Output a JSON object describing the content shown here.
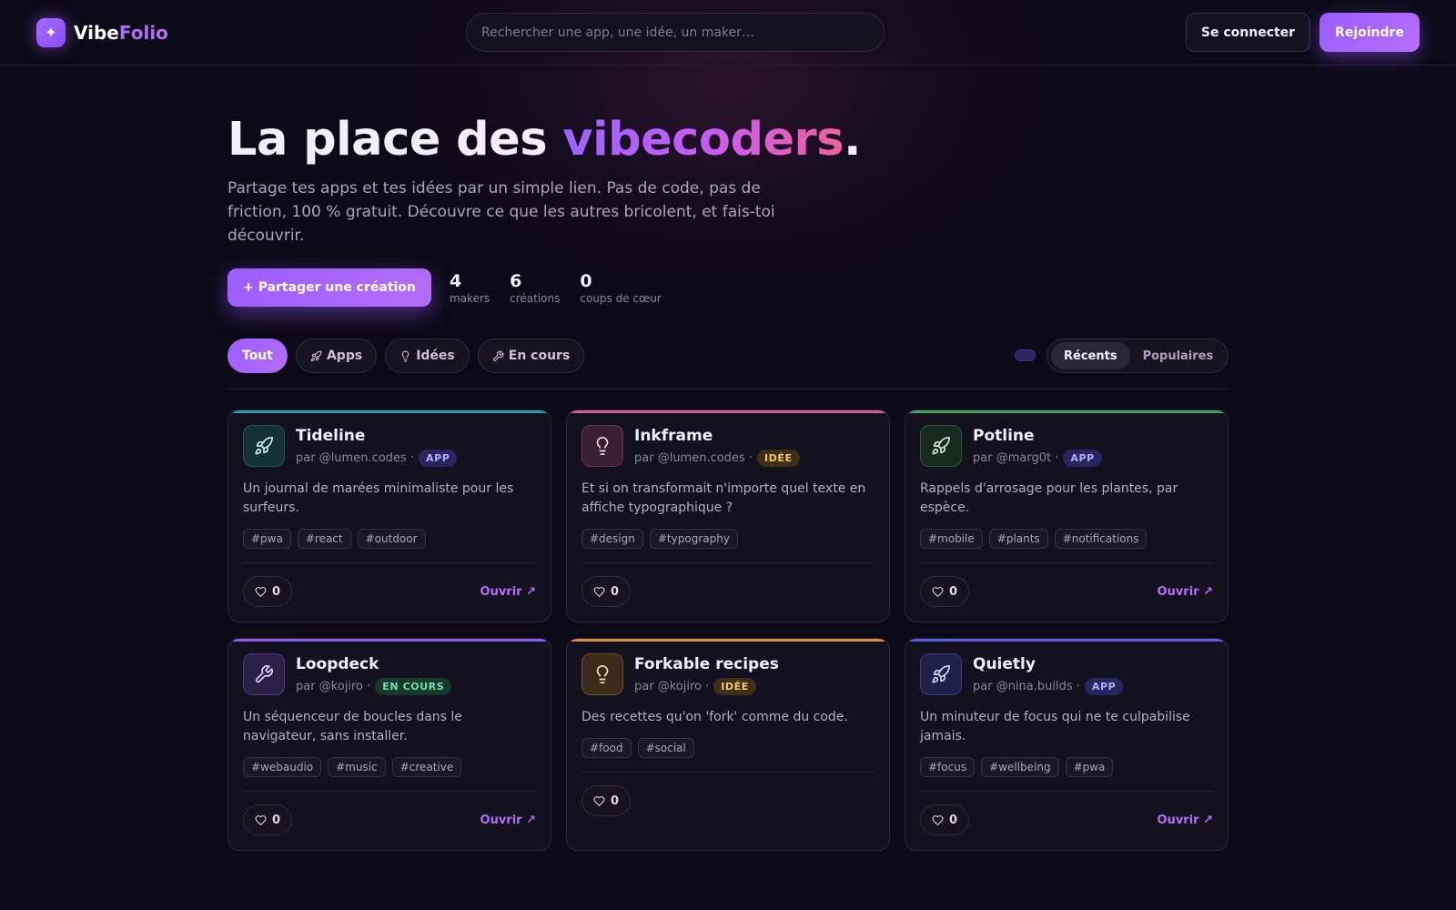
{
  "header": {
    "logo_part1": "Vibe",
    "logo_part2": "Folio",
    "logo_symbol": "✦",
    "search_placeholder": "Rechercher une app, une idée, un maker…",
    "login_label": "Se connecter",
    "join_label": "Rejoindre"
  },
  "hero": {
    "title_before": "La place des ",
    "title_highlight": "vibecoders",
    "title_after": ".",
    "subtitle": "Partage tes apps et tes idées par un simple lien. Pas de code, pas de friction, 100 % gratuit. Découvre ce que les autres bricolent, et fais-toi découvrir.",
    "share_label": "+ Partager une création",
    "stats": [
      {
        "value": "4",
        "label": "makers"
      },
      {
        "value": "6",
        "label": "créations"
      },
      {
        "value": "0",
        "label": "coups de cœur"
      }
    ]
  },
  "filters": {
    "items": [
      {
        "label": "Tout",
        "icon": "",
        "active": true
      },
      {
        "label": "Apps",
        "icon": "rocket-icon",
        "active": false
      },
      {
        "label": "Idées",
        "icon": "lightbulb-icon",
        "active": false
      },
      {
        "label": "En cours",
        "icon": "wrench-icon",
        "active": false
      }
    ],
    "sort_recent": "Récents",
    "sort_popular": "Populaires"
  },
  "cards": [
    {
      "title": "Tideline",
      "author": "par @lumen.codes ·",
      "badge": "APP",
      "description": "Un journal de marées minimaliste pour les surfeurs.",
      "tags": [
        "#pwa",
        "#react",
        "#outdoor"
      ],
      "likes": "0",
      "open": "Ouvrir ↗",
      "icon": "rocket-icon",
      "accent": "#2a9aa8",
      "icon_bg": "#163038",
      "icon_border": "#1f5560",
      "icon_color": "#bff0f5",
      "badge_bg": "#2a2560",
      "badge_color": "#b7adff"
    },
    {
      "title": "Inkframe",
      "author": "par @lumen.codes ·",
      "badge": "IDÉE",
      "description": "Et si on transformait n'importe quel texte en affiche typographique ?",
      "tags": [
        "#design",
        "#typography"
      ],
      "likes": "0",
      "open": "",
      "icon": "lightbulb-icon",
      "accent": "#d05f9a",
      "icon_bg": "#3a1f31",
      "icon_border": "#6a3357",
      "icon_color": "#f4d3e6",
      "badge_bg": "#3d3016",
      "badge_color": "#f2c66a"
    },
    {
      "title": "Potline",
      "author": "par @marg0t ·",
      "badge": "APP",
      "description": "Rappels d'arrosage pour les plantes, par espèce.",
      "tags": [
        "#mobile",
        "#plants",
        "#notifications"
      ],
      "likes": "0",
      "open": "Ouvrir ↗",
      "icon": "rocket-icon",
      "accent": "#3fa35a",
      "icon_bg": "#172a1f",
      "icon_border": "#285a37",
      "icon_color": "#cdeed6",
      "badge_bg": "#2a2560",
      "badge_color": "#b7adff"
    },
    {
      "title": "Loopdeck",
      "author": "par @kojiro ·",
      "badge": "EN COURS",
      "description": "Un séquenceur de boucles dans le navigateur, sans installer.",
      "tags": [
        "#webaudio",
        "#music",
        "#creative"
      ],
      "likes": "0",
      "open": "Ouvrir ↗",
      "icon": "wrench-icon",
      "accent": "#8a5cf0",
      "icon_bg": "#2a1f45",
      "icon_border": "#4b3785",
      "icon_color": "#e2d6ff",
      "badge_bg": "#173a2d",
      "badge_color": "#6fe0ad"
    },
    {
      "title": "Forkable recipes",
      "author": "par @kojiro ·",
      "badge": "IDÉE",
      "description": "Des recettes qu'on 'fork' comme du code.",
      "tags": [
        "#food",
        "#social"
      ],
      "likes": "0",
      "open": "",
      "icon": "lightbulb-icon",
      "accent": "#d9913a",
      "icon_bg": "#3a2a17",
      "icon_border": "#6e4f27",
      "icon_color": "#f7e0c2",
      "badge_bg": "#3d3016",
      "badge_color": "#f2c66a"
    },
    {
      "title": "Quietly",
      "author": "par @nina.builds ·",
      "badge": "APP",
      "description": "Un minuteur de focus qui ne te culpabilise jamais.",
      "tags": [
        "#focus",
        "#wellbeing",
        "#pwa"
      ],
      "likes": "0",
      "open": "Ouvrir ↗",
      "icon": "rocket-icon",
      "accent": "#5d5ae6",
      "icon_bg": "#22204a",
      "icon_border": "#3c3a85",
      "icon_color": "#d9d7ff",
      "badge_bg": "#2a2560",
      "badge_color": "#b7adff"
    }
  ]
}
